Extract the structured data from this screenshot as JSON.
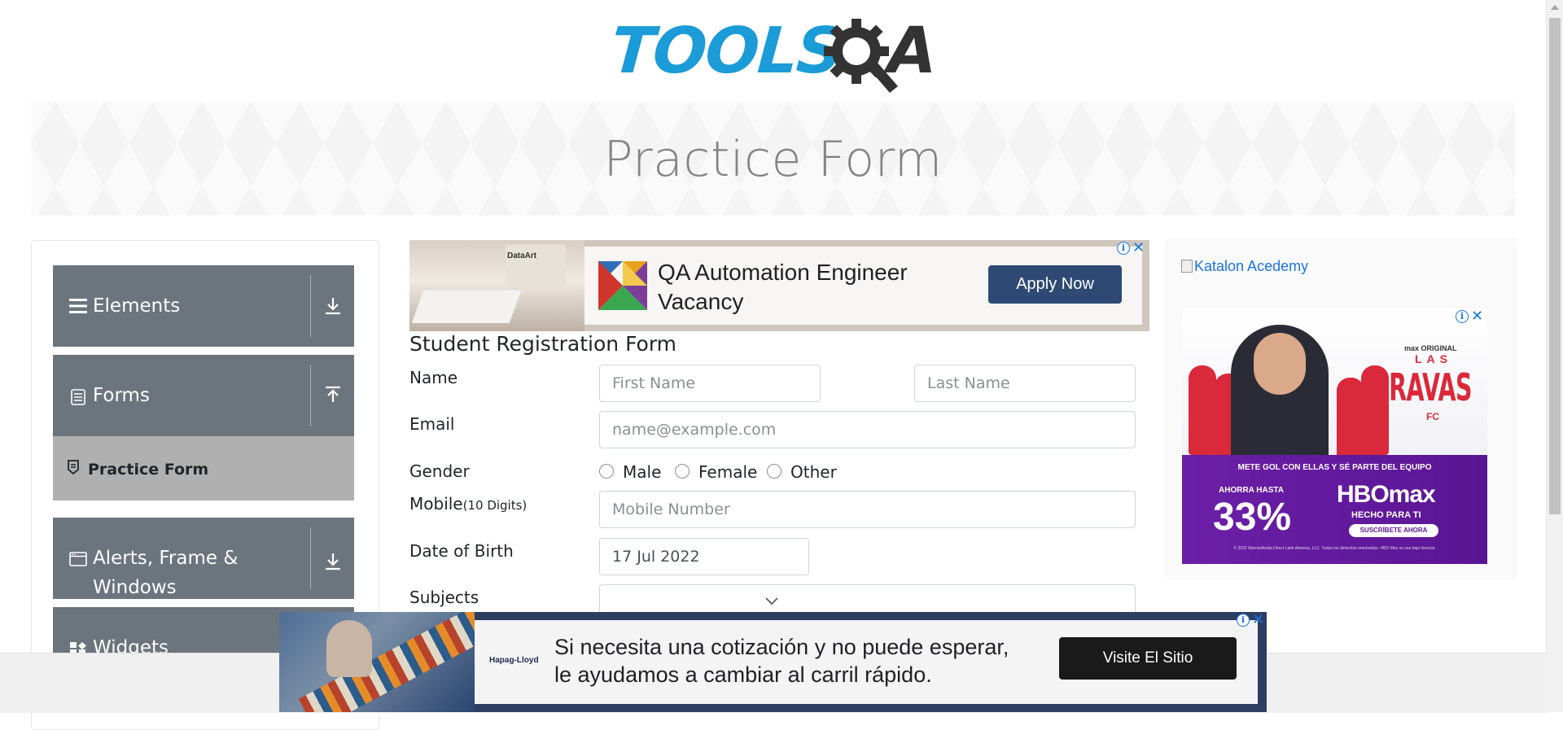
{
  "logo": {
    "part1": "TOOLS",
    "part2": "A"
  },
  "banner": {
    "title": "Practice Form"
  },
  "nav": {
    "groups": [
      {
        "label": "Elements",
        "icon": "hamburger-icon",
        "arrow": "download-arrow-icon"
      },
      {
        "label": "Forms",
        "icon": "document-icon",
        "arrow": "upload-arrow-icon"
      },
      {
        "label_line1": "Alerts, Frame &",
        "label_line2": "Windows",
        "icon": "window-icon",
        "arrow": "download-arrow-icon"
      },
      {
        "label": "Widgets",
        "icon": "widgets-icon"
      }
    ],
    "active_item": {
      "label": "Practice Form",
      "icon": "form-badge-icon"
    }
  },
  "ad_top": {
    "brand": "DataArt",
    "headline": "QA Automation Engineer Vacancy",
    "button": "Apply Now"
  },
  "form": {
    "title": "Student Registration Form",
    "name_label": "Name",
    "first_name_placeholder": "First Name",
    "last_name_placeholder": "Last Name",
    "email_label": "Email",
    "email_placeholder": "name@example.com",
    "gender_label": "Gender",
    "gender_options": [
      "Male",
      "Female",
      "Other"
    ],
    "mobile_label": "Mobile",
    "mobile_hint": "(10 Digits)",
    "mobile_placeholder": "Mobile Number",
    "dob_label": "Date of Birth",
    "dob_value": "17 Jul 2022",
    "subjects_label": "Subjects"
  },
  "ad_right": {
    "broken_image_alt": "Katalon Acedemy",
    "small_brand": "max ORIGINAL",
    "las": "LAS",
    "title": "BRAVAS",
    "fc": "FC",
    "tagline": "METE GOL CON ELLAS Y SÉ PARTE DEL EQUIPO",
    "ahorra": "AHORRA HASTA",
    "percent": "33%",
    "hbomax": "HBOmax",
    "hecho": "HECHO PARA TI",
    "suscribete": "SUSCRÍBETE AHORA",
    "fine_print": "© 2022 WarnerMedia Direct Latin America, LLC. Todos los derechos reservados. HBO Max se usa bajo licencia."
  },
  "ad_bottom": {
    "brand": "Hapag-Lloyd",
    "line1": "Si necesita una cotización y no puede esperar,",
    "line2": "le ayudamos a cambiar al carril rápido.",
    "button": "Visite El Sitio"
  },
  "colors": {
    "logo_blue": "#1b9bd7",
    "nav_group_bg": "#6c757d",
    "nav_active_bg": "#b0b0b0",
    "apply_button": "#2e4a74",
    "visit_button": "#1a1a1a",
    "ad_link": "#1a73e8"
  }
}
